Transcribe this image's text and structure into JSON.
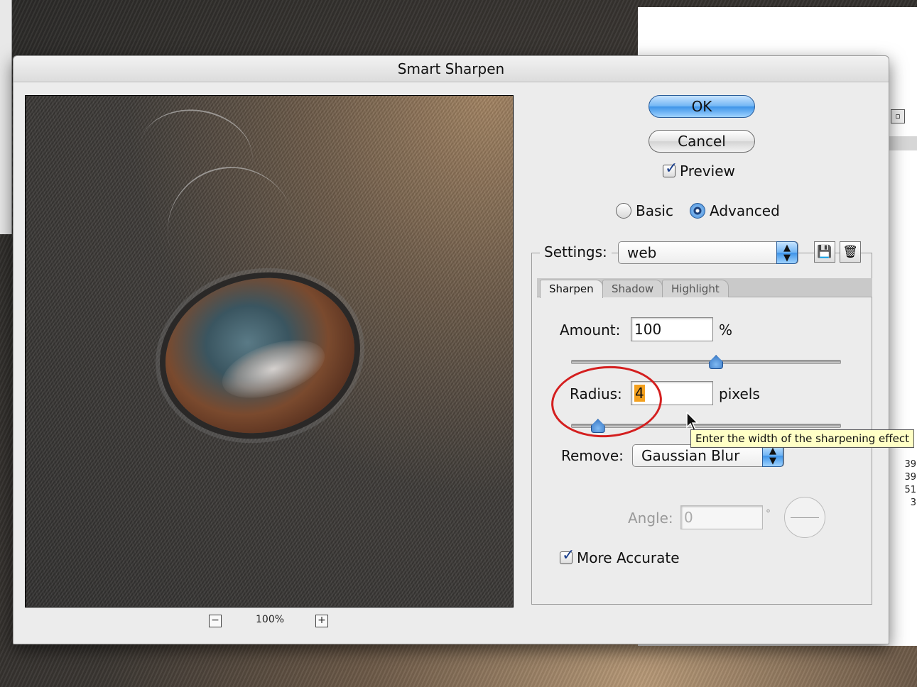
{
  "dialog": {
    "title": "Smart Sharpen"
  },
  "preview": {
    "zoom_level": "100%",
    "zoom_out": "−",
    "zoom_in": "+"
  },
  "buttons": {
    "ok": "OK",
    "cancel": "Cancel"
  },
  "preview_toggle": {
    "label": "Preview",
    "checked": true
  },
  "mode": {
    "basic": "Basic",
    "advanced": "Advanced",
    "selected": "Advanced"
  },
  "settings": {
    "label": "Settings:",
    "value": "web"
  },
  "tabs": [
    {
      "label": "Sharpen",
      "active": true
    },
    {
      "label": "Shadow",
      "active": false
    },
    {
      "label": "Highlight",
      "active": false
    }
  ],
  "amount": {
    "label": "Amount:",
    "value": "100",
    "unit": "%",
    "slider_fraction": 0.54
  },
  "radius": {
    "label": "Radius:",
    "value": "4",
    "unit": "pixels",
    "slider_fraction": 0.1
  },
  "remove": {
    "label": "Remove:",
    "value": "Gaussian Blur"
  },
  "angle": {
    "label": "Angle:",
    "value": "0",
    "unit": "°"
  },
  "more_accurate": {
    "label": "More Accurate",
    "checked": true
  },
  "tooltip": {
    "text": "Enter the width of the sharpening effect"
  },
  "background_panel": {
    "numbers": [
      "39",
      "39",
      "51",
      "3"
    ]
  },
  "icons": {
    "arrows": "popup-arrows-icon",
    "save": "save-settings-icon",
    "trash": "trash-icon"
  },
  "colors": {
    "accent": "#3d93e8",
    "highlight": "#f3a01e",
    "annotation": "#d41f1f",
    "tooltip_bg": "#ffffc6"
  }
}
